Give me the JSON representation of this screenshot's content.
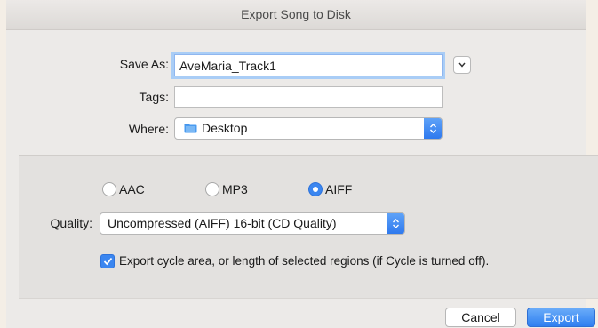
{
  "window": {
    "title": "Export Song to Disk"
  },
  "form": {
    "save_as_label": "Save As:",
    "save_as_value": "AveMaria_Track1",
    "tags_label": "Tags:",
    "tags_value": "",
    "where_label": "Where:",
    "where_value": "Desktop"
  },
  "format": {
    "options": [
      "AAC",
      "MP3",
      "AIFF"
    ],
    "selected": "AIFF",
    "quality_label": "Quality:",
    "quality_value": "Uncompressed (AIFF) 16-bit (CD Quality)",
    "cycle_checkbox_label": "Export cycle area, or length of selected regions (if Cycle is turned off).",
    "cycle_checked": true
  },
  "buttons": {
    "cancel": "Cancel",
    "export": "Export"
  },
  "colors": {
    "accent": "#3b86f0",
    "focus_ring": "#a9cdf6"
  }
}
